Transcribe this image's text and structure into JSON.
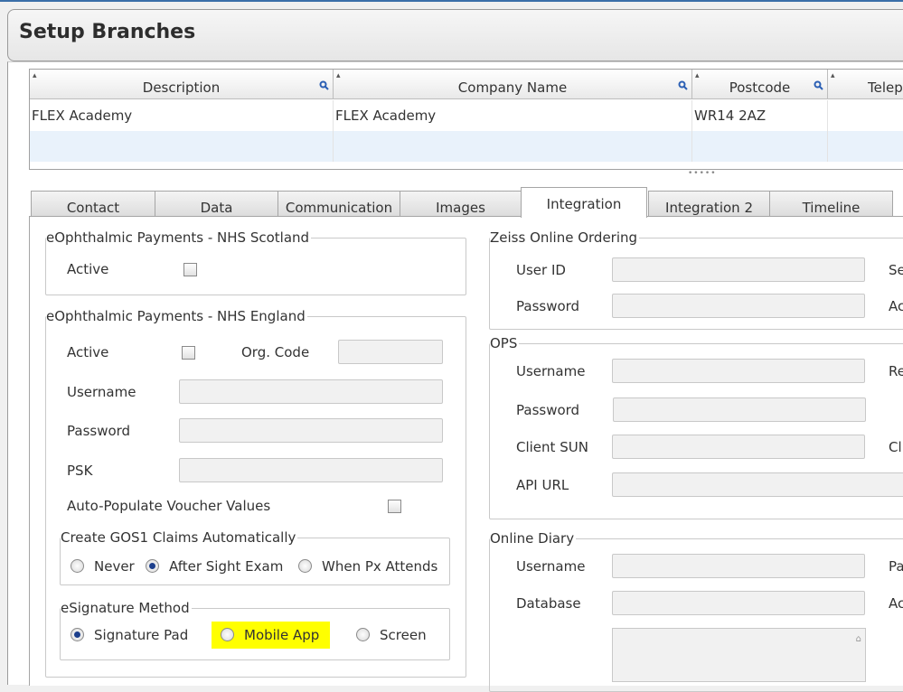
{
  "window": {
    "title": "Setup Branches"
  },
  "grid": {
    "columns": [
      "Description",
      "Company Name",
      "Postcode",
      "Telep"
    ],
    "rows": [
      [
        "FLEX Academy",
        "FLEX Academy",
        "WR14 2AZ",
        ""
      ]
    ],
    "grip": "•••••"
  },
  "tabs": [
    "Contact",
    "Data",
    "Communication",
    "Images",
    "Integration",
    "Integration 2",
    "Timeline"
  ],
  "active_tab": "Integration",
  "left": {
    "nhs_scotland": {
      "legend": "eOphthalmic Payments - NHS Scotland",
      "active_label": "Active"
    },
    "nhs_england": {
      "legend": "eOphthalmic Payments - NHS England",
      "active_label": "Active",
      "org_code_label": "Org. Code",
      "org_code_value": "",
      "username_label": "Username",
      "username_value": "",
      "password_label": "Password",
      "password_value": "",
      "psk_label": "PSK",
      "psk_value": "",
      "auto_populate_label": "Auto-Populate Voucher Values"
    },
    "gos1": {
      "legend": "Create GOS1 Claims Automatically",
      "options": [
        "Never",
        "After Sight Exam",
        "When Px Attends"
      ],
      "selected": "After Sight Exam"
    },
    "esignature": {
      "legend": "eSignature Method",
      "options": [
        "Signature Pad",
        "Mobile App",
        "Screen"
      ],
      "selected": "Signature Pad",
      "highlight_color": "#ffff00"
    }
  },
  "right": {
    "zeiss": {
      "legend": "Zeiss Online Ordering",
      "user_id_label": "User ID",
      "password_label": "Password",
      "side_labels": [
        "Se",
        "Ac"
      ]
    },
    "ops": {
      "legend": "OPS",
      "username_label": "Username",
      "password_label": "Password",
      "client_sun_label": "Client SUN",
      "api_url_label": "API URL",
      "side_labels": [
        "Re",
        "Cl"
      ]
    },
    "online_diary": {
      "legend": "Online Diary",
      "username_label": "Username",
      "database_label": "Database",
      "side_labels": [
        "Pa",
        "Ac"
      ]
    }
  },
  "colors": {
    "accent": "#1c3f8c",
    "grid_alt_row": "#e9f2fb",
    "highlight": "#ffff00"
  }
}
